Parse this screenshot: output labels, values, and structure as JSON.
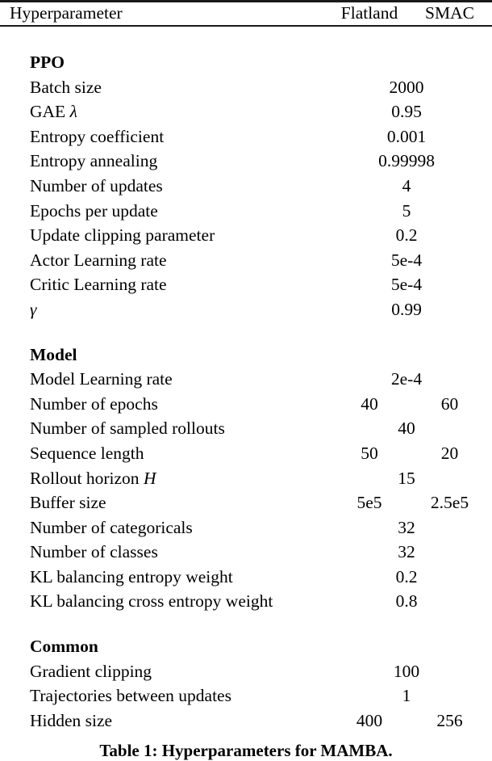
{
  "table": {
    "header": {
      "row_label": "Hyperparameter",
      "columns": [
        "Flatland",
        "SMAC"
      ]
    },
    "rules": {
      "color": "#1a1a1a"
    },
    "rows": [
      {
        "type": "gap"
      },
      {
        "type": "section",
        "label": "PPO"
      },
      {
        "type": "data",
        "label": "Batch size",
        "span": "2000"
      },
      {
        "type": "data",
        "label": "GAE ",
        "sym": "λ",
        "span": "0.95"
      },
      {
        "type": "data",
        "label": "Entropy coefficient",
        "span": "0.001"
      },
      {
        "type": "data",
        "label": "Entropy annealing",
        "span": "0.99998"
      },
      {
        "type": "data",
        "label": "Number of updates",
        "span": "4"
      },
      {
        "type": "data",
        "label": "Epochs per update",
        "span": "5"
      },
      {
        "type": "data",
        "label": "Update clipping parameter",
        "span": "0.2"
      },
      {
        "type": "data",
        "label": "Actor Learning rate",
        "span": "5e-4"
      },
      {
        "type": "data",
        "label": "Critic Learning rate",
        "span": "5e-4"
      },
      {
        "type": "data",
        "label": "",
        "sym": "γ",
        "span": "0.99"
      },
      {
        "type": "gap"
      },
      {
        "type": "section",
        "label": "Model"
      },
      {
        "type": "data",
        "label": "Model Learning rate",
        "span": "2e-4"
      },
      {
        "type": "data",
        "label": "Number of epochs",
        "flatland": "40",
        "smac": "60"
      },
      {
        "type": "data",
        "label": "Number of sampled rollouts",
        "span": "40"
      },
      {
        "type": "data",
        "label": "Sequence length",
        "flatland": "50",
        "smac": "20"
      },
      {
        "type": "data",
        "label": "Rollout horizon ",
        "sym": "H",
        "span": "15"
      },
      {
        "type": "data",
        "label": "Buffer size",
        "flatland": "5e5",
        "smac": "2.5e5"
      },
      {
        "type": "data",
        "label": "Number of categoricals",
        "span": "32"
      },
      {
        "type": "data",
        "label": "Number of classes",
        "span": "32"
      },
      {
        "type": "data",
        "label": "KL balancing entropy weight",
        "span": "0.2"
      },
      {
        "type": "data",
        "label": "KL balancing cross entropy weight",
        "span": "0.8"
      },
      {
        "type": "gap"
      },
      {
        "type": "section",
        "label": "Common"
      },
      {
        "type": "data",
        "label": "Gradient clipping",
        "span": "100"
      },
      {
        "type": "data",
        "label": "Trajectories between updates",
        "span": "1"
      },
      {
        "type": "data",
        "label": "Hidden size",
        "flatland": "400",
        "smac": "256"
      }
    ]
  },
  "caption": {
    "text": "Table 1: Hyperparameters for MAMBA."
  }
}
